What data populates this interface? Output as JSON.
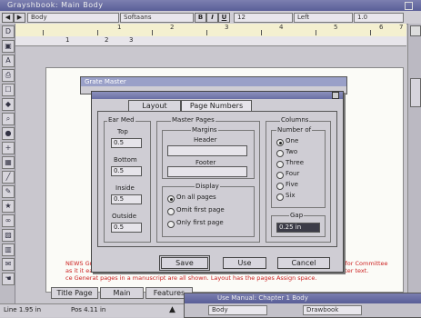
{
  "window": {
    "title": "Grayshbook: Main Body"
  },
  "format_bar": {
    "style": "Body",
    "font": "Softaans",
    "bold": "B",
    "italic": "I",
    "underline": "U",
    "size": "12",
    "align": "Left",
    "spacing": "1.0"
  },
  "ruler": {
    "numbers": [
      "1",
      "2",
      "3",
      "4",
      "5",
      "6",
      "7"
    ]
  },
  "ruler_tabs": [
    "1",
    "2",
    "3"
  ],
  "master_window": {
    "title": "Grate Master"
  },
  "dialog": {
    "tabs": [
      "Layout",
      "Page Numbers"
    ],
    "ear_med": {
      "legend": "Ear Med",
      "fields": [
        {
          "label": "Top",
          "value": "0.5"
        },
        {
          "label": "Bottom",
          "value": "0.5"
        },
        {
          "label": "Inside",
          "value": "0.5"
        },
        {
          "label": "Outside",
          "value": "0.5"
        }
      ]
    },
    "master_pages": {
      "legend": "Master Pages",
      "margins_label": "Margins",
      "header_label": "Header",
      "footer_label": "Footer",
      "display_label": "Display",
      "display_options": [
        "On all pages",
        "Omit first page",
        "Only first page"
      ],
      "display_selected": 0
    },
    "columns": {
      "legend": "Columns",
      "number_label": "Number of",
      "options": [
        "One",
        "Two",
        "Three",
        "Four",
        "Five",
        "Six"
      ],
      "selected": 0,
      "gap_label": "Gap",
      "gap_value": "0.25 in"
    },
    "buttons": {
      "save": "Save",
      "use": "Use",
      "cancel": "Cancel"
    }
  },
  "doc_text": [
    "NEWS Grayshbook: Main Body, the Master Pages dialog lets you select any layout option, and for Committee",
    "as it it easy to see. Layout options include margin settings, and the position of header and footer text.",
    "ce Generat pages in a manuscript are all shown. Layout has the pages Assign space."
  ],
  "page_tabs": [
    "Title Page",
    "Main",
    "Features"
  ],
  "status": {
    "line": "Line 1.95 in",
    "pos": "Pos 4.11 in"
  },
  "second_window": {
    "title": "Use Manual: Chapter 1 Body",
    "style": "Body",
    "font": "Drawbook"
  }
}
